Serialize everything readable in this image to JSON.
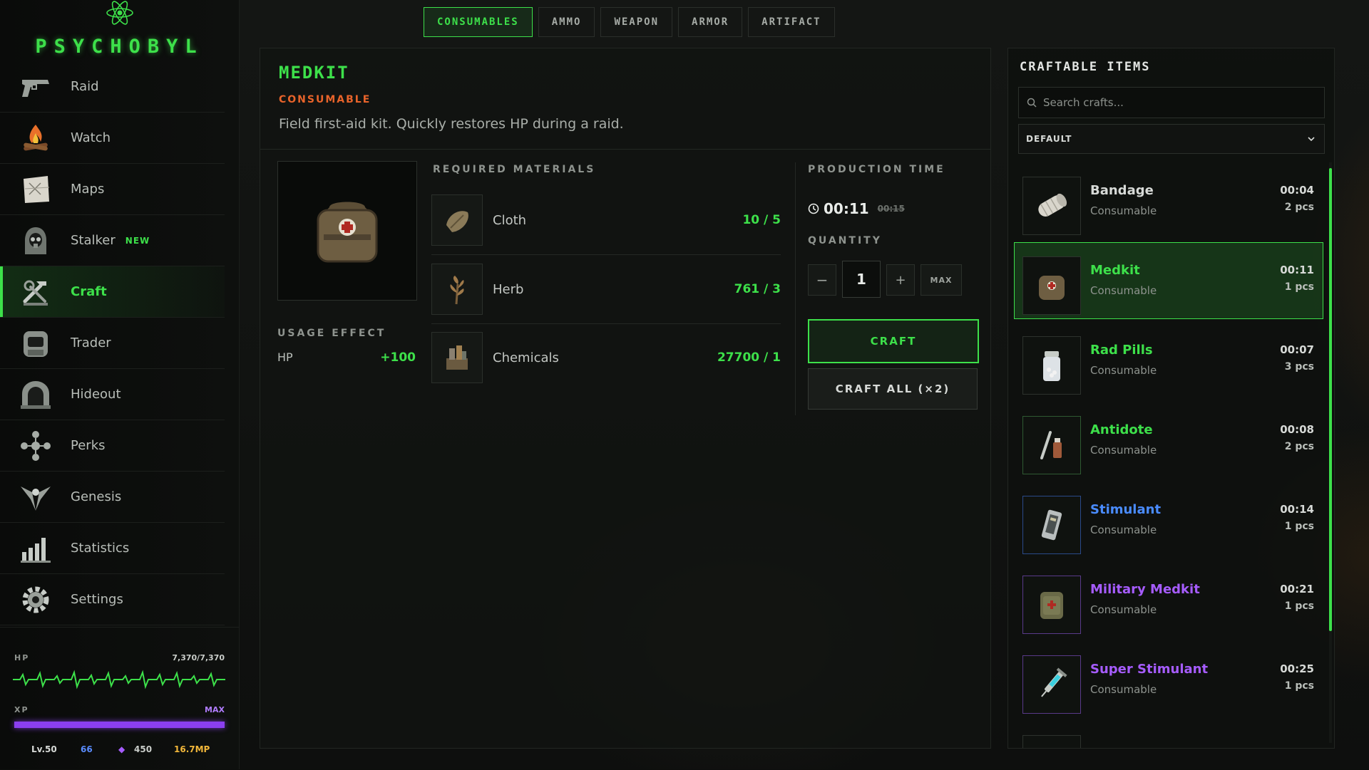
{
  "app": {
    "logo_text": "PSYCHOBYL"
  },
  "sidebar": {
    "items": [
      {
        "label": "Raid",
        "icon": "pistol-icon"
      },
      {
        "label": "Watch",
        "icon": "campfire-icon"
      },
      {
        "label": "Maps",
        "icon": "map-icon"
      },
      {
        "label": "Stalker",
        "icon": "stalker-icon",
        "badge": "NEW"
      },
      {
        "label": "Craft",
        "icon": "craft-tools-icon",
        "active": true
      },
      {
        "label": "Trader",
        "icon": "trader-icon"
      },
      {
        "label": "Hideout",
        "icon": "hideout-icon"
      },
      {
        "label": "Perks",
        "icon": "perks-icon"
      },
      {
        "label": "Genesis",
        "icon": "genesis-icon"
      },
      {
        "label": "Statistics",
        "icon": "statistics-icon"
      },
      {
        "label": "Settings",
        "icon": "settings-gear-icon"
      }
    ]
  },
  "player": {
    "hp_label": "HP",
    "hp_value": "7,370/7,370",
    "xp_label": "XP",
    "xp_value": "MAX",
    "xp_fill": 1.0,
    "level": "Lv.50",
    "credits": "66",
    "crystals": "450",
    "money": "16.7MP"
  },
  "tabs": [
    {
      "label": "CONSUMABLES",
      "active": true
    },
    {
      "label": "AMMO"
    },
    {
      "label": "WEAPON"
    },
    {
      "label": "ARMOR"
    },
    {
      "label": "ARTIFACT"
    }
  ],
  "detail": {
    "title": "MEDKIT",
    "type": "CONSUMABLE",
    "description": "Field first-aid kit. Quickly restores HP during a raid.",
    "usage_heading": "USAGE EFFECT",
    "effect_name": "HP",
    "effect_value": "+100",
    "materials_heading": "REQUIRED MATERIALS",
    "materials": [
      {
        "name": "Cloth",
        "count": "10 / 5",
        "icon": "cloth-icon"
      },
      {
        "name": "Herb",
        "count": "761 / 3",
        "icon": "herb-icon"
      },
      {
        "name": "Chemicals",
        "count": "27700 / 1",
        "icon": "chemicals-icon"
      }
    ],
    "production_heading": "PRODUCTION TIME",
    "production_time": "00:11",
    "production_time_old": "00:15",
    "quantity_heading": "QUANTITY",
    "quantity": "1",
    "minus_label": "−",
    "plus_label": "+",
    "max_label": "MAX",
    "craft_label": "CRAFT",
    "craft_all_label": "CRAFT ALL (×2)"
  },
  "craftable": {
    "title": "CRAFTABLE ITEMS",
    "search_placeholder": "Search crafts...",
    "sort_value": "DEFAULT",
    "items": [
      {
        "name": "Bandage",
        "type": "Consumable",
        "time": "00:04",
        "qty": "2 pcs",
        "color": "#d7dad7",
        "rarity_border": "#2d322d",
        "icon": "bandage-icon"
      },
      {
        "name": "Medkit",
        "type": "Consumable",
        "time": "00:11",
        "qty": "1 pcs",
        "color": "#3de04a",
        "rarity_border": "#2d322d",
        "icon": "medkit-icon",
        "active": true
      },
      {
        "name": "Rad Pills",
        "type": "Consumable",
        "time": "00:07",
        "qty": "3 pcs",
        "color": "#3de04a",
        "rarity_border": "#2d322d",
        "icon": "pills-icon"
      },
      {
        "name": "Antidote",
        "type": "Consumable",
        "time": "00:08",
        "qty": "2 pcs",
        "color": "#3de04a",
        "rarity_border": "#2f5a32",
        "icon": "antidote-icon"
      },
      {
        "name": "Stimulant",
        "type": "Consumable",
        "time": "00:14",
        "qty": "1 pcs",
        "color": "#4a8cff",
        "rarity_border": "#2a4a8a",
        "icon": "stimulant-icon"
      },
      {
        "name": "Military Medkit",
        "type": "Consumable",
        "time": "00:21",
        "qty": "1 pcs",
        "color": "#a65cff",
        "rarity_border": "#5a3a8a",
        "icon": "military-medkit-icon"
      },
      {
        "name": "Super Stimulant",
        "type": "Consumable",
        "time": "00:25",
        "qty": "1 pcs",
        "color": "#a65cff",
        "rarity_border": "#5a3a8a",
        "icon": "super-stimulant-icon"
      }
    ]
  }
}
